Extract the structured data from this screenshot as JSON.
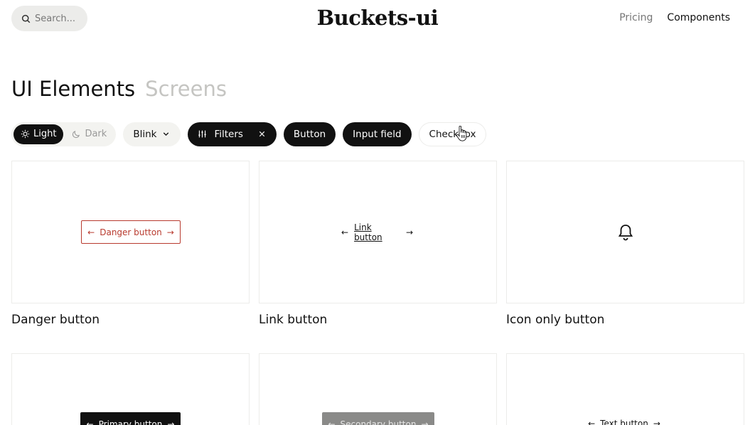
{
  "header": {
    "search_placeholder": "Search...",
    "logo": "Buckets-ui",
    "nav": {
      "pricing": "Pricing",
      "components": "Components"
    }
  },
  "title": {
    "active": "UI Elements",
    "inactive": "Screens"
  },
  "filters": {
    "theme_light": "Light",
    "theme_dark": "Dark",
    "variant": "Blink",
    "filters_label": "Filters",
    "chips": [
      "Button",
      "Input field",
      "Checkbox"
    ]
  },
  "cards": [
    {
      "label": "Danger button",
      "preview": "Danger button"
    },
    {
      "label": "Link button",
      "preview": "Link button"
    },
    {
      "label": "Icon only button",
      "preview": ""
    },
    {
      "label": "",
      "preview": "Primary button"
    },
    {
      "label": "",
      "preview": "Secondary button"
    },
    {
      "label": "",
      "preview": "Text button"
    }
  ],
  "arrows": {
    "left": "←",
    "right": "→"
  },
  "colors": {
    "danger": "#b83a2e",
    "dark": "#111111",
    "muted": "#c5c5c2"
  }
}
